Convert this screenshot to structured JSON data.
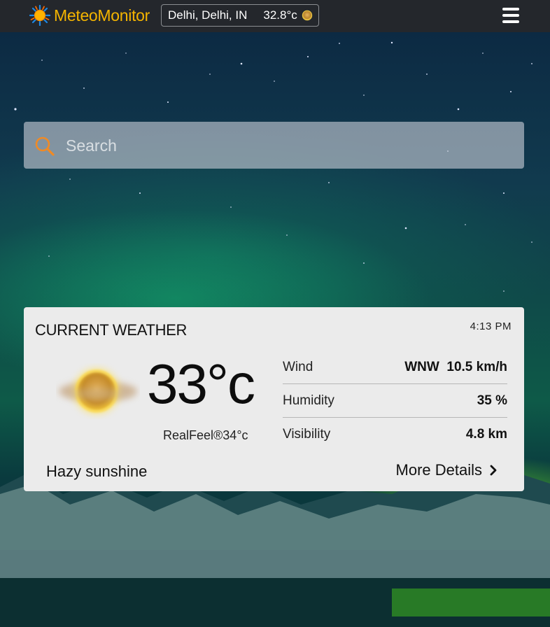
{
  "header": {
    "brand": "MeteoMonitor",
    "location": "Delhi, Delhi, IN",
    "location_temp": "32.8°c",
    "menu_icon": "hamburger-icon"
  },
  "search": {
    "placeholder": "Search",
    "value": "",
    "icon": "search-icon"
  },
  "current_weather": {
    "title": "CURRENT WEATHER",
    "time": "4:13 PM",
    "temperature": "33°c",
    "realfeel": "RealFeel®34°c",
    "condition": "Hazy sunshine",
    "condition_icon": "hazy-sun-icon",
    "details": [
      {
        "label": "Wind",
        "value": "WNW  10.5 km/h"
      },
      {
        "label": "Humidity",
        "value": "35 %"
      },
      {
        "label": "Visibility",
        "value": "4.8 km"
      }
    ],
    "more_label": "More Details"
  },
  "colors": {
    "brand": "#f4b400",
    "topbar": "#24272c",
    "card": "#ebebeb"
  }
}
